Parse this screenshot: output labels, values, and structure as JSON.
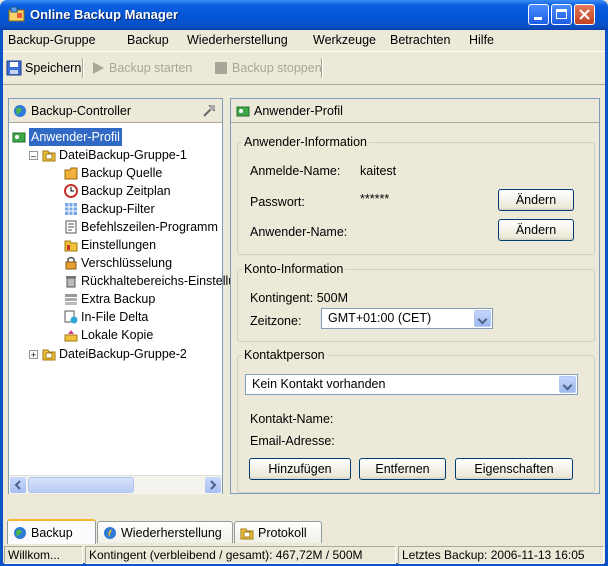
{
  "window": {
    "title": "Online Backup Manager"
  },
  "menu": [
    "Backup-Gruppe",
    "Backup",
    "Wiederherstellung",
    "Werkzeuge",
    "Betrachten",
    "Hilfe"
  ],
  "toolbar": {
    "save": "Speichern",
    "start": "Backup starten",
    "stop": "Backup stoppen"
  },
  "left": {
    "header": "Backup-Controller",
    "tree": {
      "root": "Anwender-Profil",
      "group1": "DateiBackup-Gruppe-1",
      "items": [
        "Backup Quelle",
        "Backup Zeitplan",
        "Backup-Filter",
        "Befehlszeilen-Programm",
        "Einstellungen",
        "Verschlüsselung",
        "Rückhaltebereichs-Einstellungen",
        "Extra Backup",
        "In-File Delta",
        "Lokale Kopie"
      ],
      "group2": "DateiBackup-Gruppe-2"
    }
  },
  "right": {
    "header": "Anwender-Profil",
    "user_info": {
      "legend": "Anwender-Information",
      "login_label": "Anmelde-Name:",
      "login_value": "kaitest",
      "password_label": "Passwort:",
      "password_value": "******",
      "change1": "Ändern",
      "username_label": "Anwender-Name:",
      "change2": "Ändern"
    },
    "account_info": {
      "legend": "Konto-Information",
      "quota": "Kontingent: 500M",
      "timezone_label": "Zeitzone:",
      "timezone_value": "GMT+01:00 (CET)"
    },
    "contact": {
      "legend": "Kontaktperson",
      "select_value": "Kein Kontakt vorhanden",
      "name_label": "Kontakt-Name:",
      "email_label": "Email-Adresse:",
      "add": "Hinzufügen",
      "remove": "Entfernen",
      "properties": "Eigenschaften"
    }
  },
  "tabs": [
    "Backup",
    "Wiederherstellung",
    "Protokoll"
  ],
  "status": {
    "welcome": "Willkom...",
    "quota": "Kontingent (verbleibend / gesamt): 467,72M / 500M",
    "last_backup": "Letztes Backup: 2006-11-13 16:05"
  }
}
